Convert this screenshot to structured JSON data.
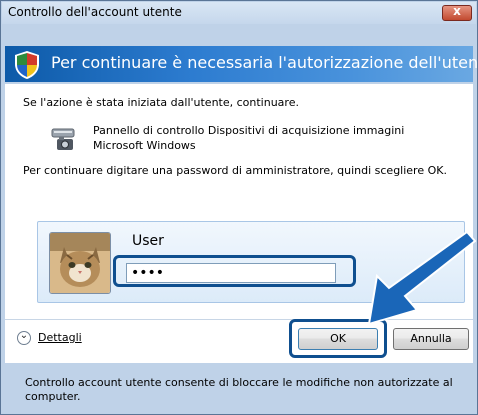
{
  "window": {
    "title": "Controllo dell'account utente",
    "close_label": "x"
  },
  "header": {
    "text": "Per continuare è necessaria l'autorizzazione dell'utente"
  },
  "body": {
    "intro": "Se l'azione è stata iniziata dall'utente, continuare.",
    "program_name": "Pannello di controllo Dispositivi di acquisizione immagini Microsoft Windows",
    "instruction": "Per continuare digitare una password di amministratore, quindi scegliere OK."
  },
  "credentials": {
    "username": "User",
    "password_value": "••••"
  },
  "actions": {
    "details_label": "Dettagli",
    "ok_label": "OK",
    "cancel_label": "Annulla"
  },
  "footer": {
    "text": "Controllo account utente consente di bloccare le modifiche non autorizzate al computer."
  },
  "icons": {
    "shield": "shield-icon",
    "program": "scanner-camera-icon",
    "avatar": "user-avatar-cat",
    "details": "chevron-down-icon",
    "pointer": "arrow-pointer-icon"
  },
  "colors": {
    "header_blue": "#1d6cc0",
    "highlight_border": "#0f4f8f",
    "arrow_blue": "#1a66b8"
  }
}
